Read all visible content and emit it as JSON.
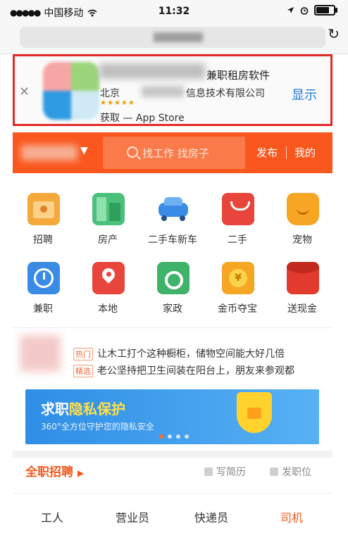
{
  "status_bar": {
    "signal_dots": "●●●●●",
    "carrier": "中国移动",
    "wifi": "wifi",
    "time": "11:32",
    "location_icon": "location-arrow",
    "alarm_icon": "alarm",
    "battery_level": 0.7
  },
  "url_bar": {
    "reload_icon": "reload"
  },
  "smart_banner": {
    "title_suffix": "兼职租房软件",
    "company_part1": "北京",
    "company_part2": "信息技术有限公司",
    "rating_stars": "★★★★★",
    "store_text": "获取 — App Store",
    "show_label": "显示",
    "close_icon": "close"
  },
  "header": {
    "search_placeholder": "找工作 找房子",
    "publish": "发布",
    "mine": "我的",
    "brand_color": "#f9571e"
  },
  "categories": [
    {
      "label": "招聘",
      "icon": "briefcase-icon",
      "color": "#f4a93a"
    },
    {
      "label": "房产",
      "icon": "building-icon",
      "color": "#4cc07a"
    },
    {
      "label": "二手车新车",
      "icon": "car-icon",
      "color": "#3a8be6"
    },
    {
      "label": "二手",
      "icon": "shopping-bag-icon",
      "color": "#e8453c"
    },
    {
      "label": "宠物",
      "icon": "cat-icon",
      "color": "#f6a623"
    },
    {
      "label": "兼职",
      "icon": "clock-icon",
      "color": "#3a8be6"
    },
    {
      "label": "本地",
      "icon": "map-pin-icon",
      "color": "#e8453c"
    },
    {
      "label": "家政",
      "icon": "washer-icon",
      "color": "#3fb36a"
    },
    {
      "label": "金币夺宝",
      "icon": "coin-icon",
      "color": "#f5a623"
    },
    {
      "label": "送现金",
      "icon": "red-envelope-icon",
      "color": "#e23b2e"
    }
  ],
  "news": {
    "tag_hot": "热门",
    "item1": "让木工打个这种橱柜，储物空间能大好几倍",
    "tag_featured": "精选",
    "item2": "老公坚持把卫生间装在阳台上，朋友来参观都"
  },
  "promo": {
    "title_plain": "求职",
    "title_highlight": "隐私保护",
    "subtitle": "360°全方位守护您的隐私安全",
    "dots_count": 4,
    "active_dot": 0
  },
  "section": {
    "title": "全职招聘",
    "write_resume": "写简历",
    "post_job": "发职位"
  },
  "job_tabs": [
    {
      "label": "工人"
    },
    {
      "label": "营业员"
    },
    {
      "label": "快递员"
    },
    {
      "label": "司机",
      "active": true
    }
  ]
}
